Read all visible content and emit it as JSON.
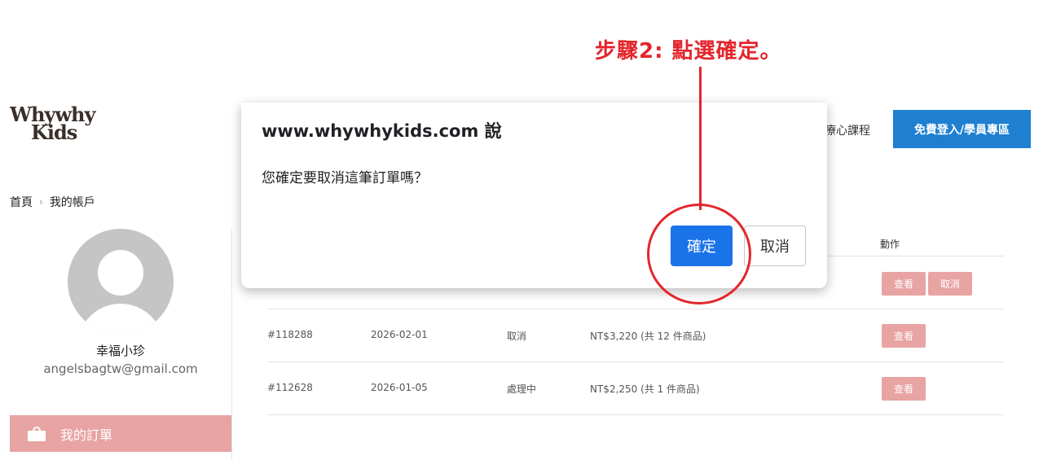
{
  "annotation": {
    "text": "步驟2: 點選確定。"
  },
  "logo": {
    "line1": "Whywhy",
    "line2": "Kids"
  },
  "nav": {
    "link": "療心課程",
    "login_label": "免費登入/學員專區"
  },
  "breadcrumb": {
    "home": "首頁",
    "separator": "›",
    "current": "我的帳戶"
  },
  "sidebar": {
    "user_name": "幸福小珍",
    "user_email": "angelsbagtw@gmail.com",
    "menu_orders": "我的訂單"
  },
  "orders": {
    "action_header": "動作",
    "rows": [
      {
        "id": "",
        "date": "",
        "status": "",
        "total": "",
        "view": "查看",
        "cancel": "取消"
      },
      {
        "id": "#118288",
        "date": "2026-02-01",
        "status": "取消",
        "total": "NT$3,220 (共 12 件商品)",
        "view": "查看"
      },
      {
        "id": "#112628",
        "date": "2026-01-05",
        "status": "處理中",
        "total": "NT$2,250 (共 1 件商品)",
        "view": "查看"
      }
    ]
  },
  "dialog": {
    "title": "www.whywhykids.com 說",
    "message": "您確定要取消這筆訂單嗎？",
    "ok_label": "確定",
    "cancel_label": "取消"
  },
  "colors": {
    "accent_pink": "#e8a3a3",
    "brand_blue": "#1f7fd1",
    "dialog_blue": "#1a73e8",
    "annotation_red": "#e3262c"
  }
}
